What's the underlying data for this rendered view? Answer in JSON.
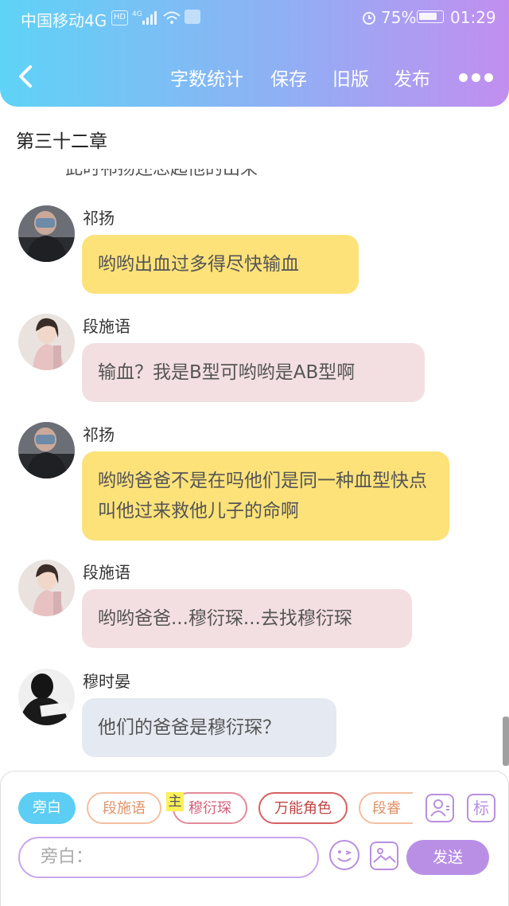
{
  "status_bar": {
    "carrier": "中国移动4G",
    "battery": "75%",
    "time": "01:29"
  },
  "header": {
    "actions": [
      "字数统计",
      "保存",
      "旧版",
      "发布"
    ]
  },
  "chapter": {
    "title": "第三十二章"
  },
  "chat": {
    "cut_text": "此时祁扬还忘起他的出来",
    "messages": [
      {
        "name": "祁扬",
        "text": "哟哟出血过多得尽快输血"
      },
      {
        "name": "段施语",
        "text": "输血？我是B型可哟哟是AB型啊"
      },
      {
        "name": "祁扬",
        "text": "哟哟爸爸不是在吗他们是同一种血型快点叫他过来救他儿子的命啊"
      },
      {
        "name": "段施语",
        "text": "哟哟爸爸...穆衍琛...去找穆衍琛"
      },
      {
        "name": "穆时晏",
        "text": "他们的爸爸是穆衍琛？"
      }
    ],
    "colors": {
      "yellow": "#fde27a",
      "pink": "#f3dfe1",
      "blue": "#e5e9f1"
    }
  },
  "input_panel": {
    "roles": [
      "旁白",
      "段施语",
      "穆衍琛",
      "万能角色",
      "段睿"
    ],
    "main_badge": "主",
    "mark_button": "标",
    "placeholder": "旁白：",
    "send_label": "发送"
  }
}
